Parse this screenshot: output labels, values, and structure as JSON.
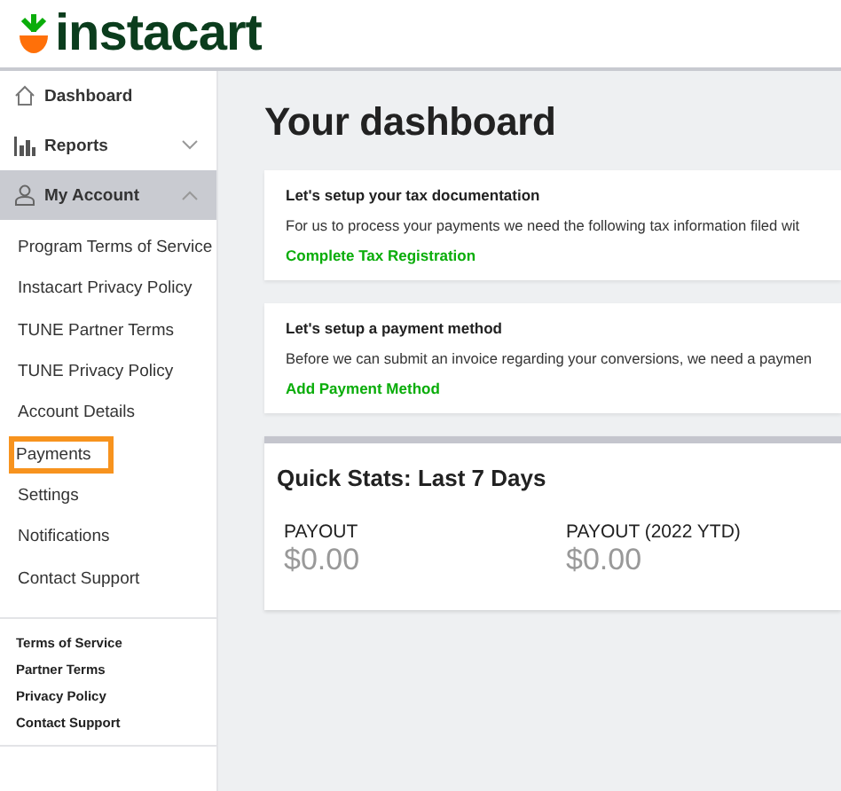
{
  "logo": {
    "text": "instacart"
  },
  "sidebar": {
    "nav": [
      {
        "label": "Dashboard",
        "kind": "home",
        "selected": false
      },
      {
        "label": "Reports",
        "kind": "chart",
        "selected": false,
        "expanded": false
      },
      {
        "label": "My Account",
        "kind": "person",
        "selected": true,
        "expanded": true
      }
    ],
    "subitems": [
      {
        "label": "Program Terms of Service",
        "highlighted": false
      },
      {
        "label": "Instacart Privacy Policy",
        "highlighted": false
      },
      {
        "label": "TUNE Partner Terms",
        "highlighted": false
      },
      {
        "label": "TUNE Privacy Policy",
        "highlighted": false
      },
      {
        "label": "Account Details",
        "highlighted": false
      },
      {
        "label": "Payments",
        "highlighted": true
      },
      {
        "label": "Settings",
        "highlighted": false
      },
      {
        "label": "Notifications",
        "highlighted": false
      },
      {
        "label": "Contact Support",
        "highlighted": false
      }
    ],
    "footer_links": [
      "Terms of Service",
      "Partner Terms",
      "Privacy Policy",
      "Contact Support"
    ]
  },
  "main": {
    "title": "Your dashboard",
    "cards": [
      {
        "heading": "Let's setup your tax documentation",
        "text": "For us to process your payments we need the following tax information filed wit",
        "link": "Complete Tax Registration"
      },
      {
        "heading": "Let's setup a payment method",
        "text": "Before we can submit an invoice regarding your conversions, we need a paymen",
        "link": "Add Payment Method"
      }
    ],
    "quick_stats": {
      "title": "Quick Stats: Last 7 Days",
      "stats": [
        {
          "label": "PAYOUT",
          "value": "$0.00"
        },
        {
          "label": "PAYOUT (2022 YTD)",
          "value": "$0.00"
        }
      ]
    }
  }
}
